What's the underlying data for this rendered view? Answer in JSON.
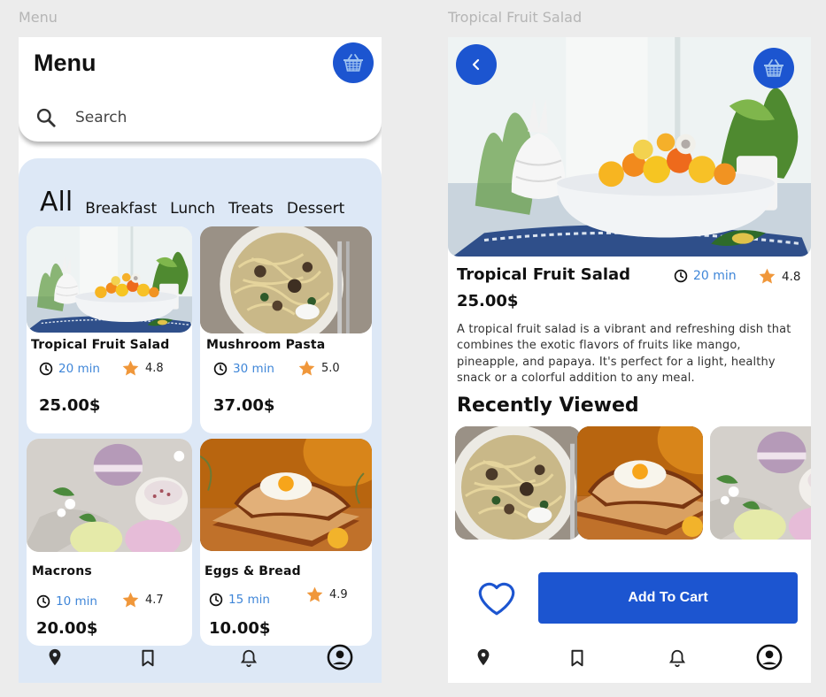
{
  "frames": {
    "menu_label": "Menu",
    "detail_label": "Tropical Fruit Salad"
  },
  "menu": {
    "title": "Menu",
    "search_placeholder": "Search",
    "categories": [
      "All",
      "Breakfast",
      "Lunch",
      "Treats",
      "Dessert"
    ],
    "active_category": "All",
    "items": [
      {
        "name": "Tropical Fruit Salad",
        "time": "20 min",
        "rating": "4.8",
        "price": "25.00$"
      },
      {
        "name": "Mushroom Pasta",
        "time": "30 min",
        "rating": "5.0",
        "price": "37.00$"
      },
      {
        "name": "Macrons",
        "time": "10 min",
        "rating": "4.7",
        "price": "20.00$"
      },
      {
        "name": "Eggs & Bread",
        "time": "15 min",
        "rating": "4.9",
        "price": "10.00$"
      }
    ]
  },
  "detail": {
    "title": "Tropical Fruit Salad",
    "time": "20 min",
    "rating": "4.8",
    "price": "25.00$",
    "description": "A tropical fruit salad is a vibrant and refreshing dish that combines the exotic flavors of fruits like mango, pineapple, and papaya. It's perfect for a light, healthy snack or a colorful addition to any meal.",
    "recent_title": "Recently Viewed",
    "add_to_cart": "Add To Cart"
  },
  "nav": [
    "location-icon",
    "bookmark-icon",
    "bell-icon",
    "profile-icon"
  ],
  "colors": {
    "accent": "#1c55d0",
    "time_text": "#3f86d8",
    "star": "#f0973a",
    "panel_bg": "#dde8f6"
  }
}
